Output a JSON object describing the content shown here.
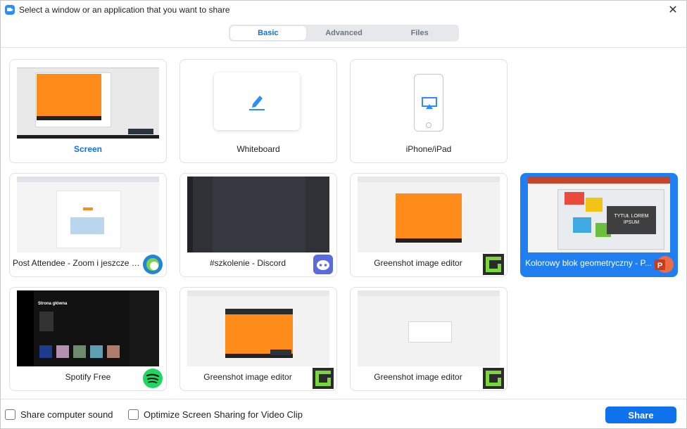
{
  "window": {
    "title": "Select a window or an application that you want to share",
    "close_glyph": "✕"
  },
  "tabs": [
    {
      "label": "Basic",
      "active": true
    },
    {
      "label": "Advanced",
      "active": false
    },
    {
      "label": "Files",
      "active": false
    }
  ],
  "tiles": [
    {
      "label": "Screen",
      "kind": "screen"
    },
    {
      "label": "Whiteboard",
      "kind": "whiteboard"
    },
    {
      "label": "iPhone/iPad",
      "kind": "ipad"
    },
    {
      "label": "Post Attendee - Zoom i jeszcze 1...",
      "app_icon": "edge-icon"
    },
    {
      "label": "#szkolenie - Discord",
      "app_icon": "discord-icon"
    },
    {
      "label": "Greenshot image editor",
      "app_icon": "greenshot-icon"
    },
    {
      "label": "Kolorowy blok geometryczny - P...",
      "app_icon": "powerpoint-icon",
      "selected": true,
      "slide_text": "TYTUŁ LOREM IPSUM"
    },
    {
      "label": "Spotify Free",
      "app_icon": "spotify-icon",
      "thumb_heading": "Strona główna"
    },
    {
      "label": "Greenshot image editor",
      "app_icon": "greenshot-icon"
    },
    {
      "label": "Greenshot image editor",
      "app_icon": "greenshot-icon"
    }
  ],
  "footer": {
    "share_sound_label": "Share computer sound",
    "optimize_label": "Optimize Screen Sharing for Video Clip",
    "share_button": "Share"
  },
  "colors": {
    "accent": "#0e72ed",
    "selected_tile": "#1f7ef0",
    "orange": "#ff8c1a"
  }
}
